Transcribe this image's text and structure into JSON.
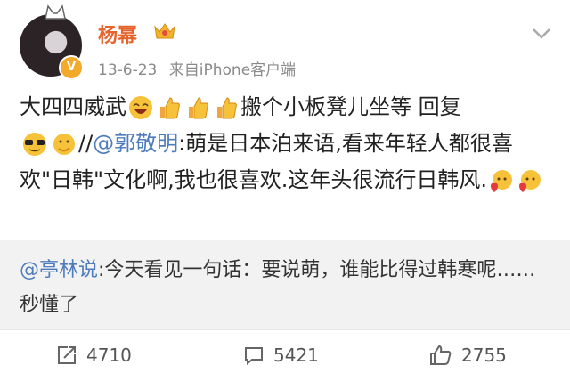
{
  "author": {
    "name": "杨幂",
    "verified_badge": "V"
  },
  "meta": {
    "date": "13-6-23",
    "source": "来自iPhone客户端"
  },
  "post": {
    "text_line1a": "大四四威武",
    "text_line1b": "搬个小板凳儿坐等 回复",
    "slashes": "//",
    "mention": "@郭敬明",
    "text_quote": ":萌是日本泊来语,看来年轻人都很喜欢\"日韩\"文化啊,我也很喜欢.这年头很流行日韩风."
  },
  "repost": {
    "mention": "@亭林说",
    "text": ":今天看见一句话：要说萌，谁能比得过韩寒呢……秒懂了"
  },
  "actions": {
    "reposts": "4710",
    "comments": "5421",
    "likes": "2755"
  },
  "colors": {
    "username": "#e6642c",
    "mention": "#4f7cbd",
    "repost_bg": "#f2f2f2"
  },
  "icons": [
    "crown-icon",
    "chevron-down-icon",
    "repost-icon",
    "comment-icon",
    "like-icon",
    "laughing-emoji",
    "thumbs-up-emoji",
    "sunglasses-emoji",
    "thinking-emoji",
    "heart-emoji"
  ]
}
